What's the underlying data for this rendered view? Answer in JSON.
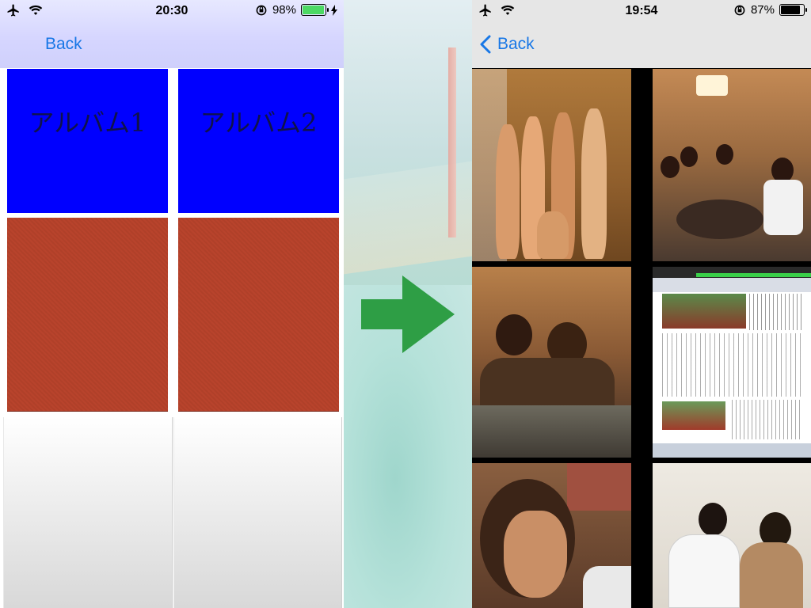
{
  "left_screen": {
    "status": {
      "time": "20:30",
      "battery": "98%",
      "battery_level": 0.98,
      "battery_color": "#4cd964"
    },
    "nav": {
      "back_label": "Back"
    },
    "albums": [
      {
        "label": "アルバム1"
      },
      {
        "label": "アルバム2"
      }
    ]
  },
  "right_screen": {
    "status": {
      "time": "19:54",
      "battery": "87%",
      "battery_level": 0.87,
      "battery_color": "#000000"
    },
    "nav": {
      "back_label": "Back"
    }
  },
  "colors": {
    "album_blue": "#0000ff",
    "accent": "#1877e6",
    "arrow_green": "#2e9e45"
  },
  "icons": [
    "airplane-icon",
    "wifi-icon",
    "rotation-lock-icon",
    "battery-icon",
    "charging-icon",
    "back-chevron-icon",
    "right-arrow-icon"
  ]
}
